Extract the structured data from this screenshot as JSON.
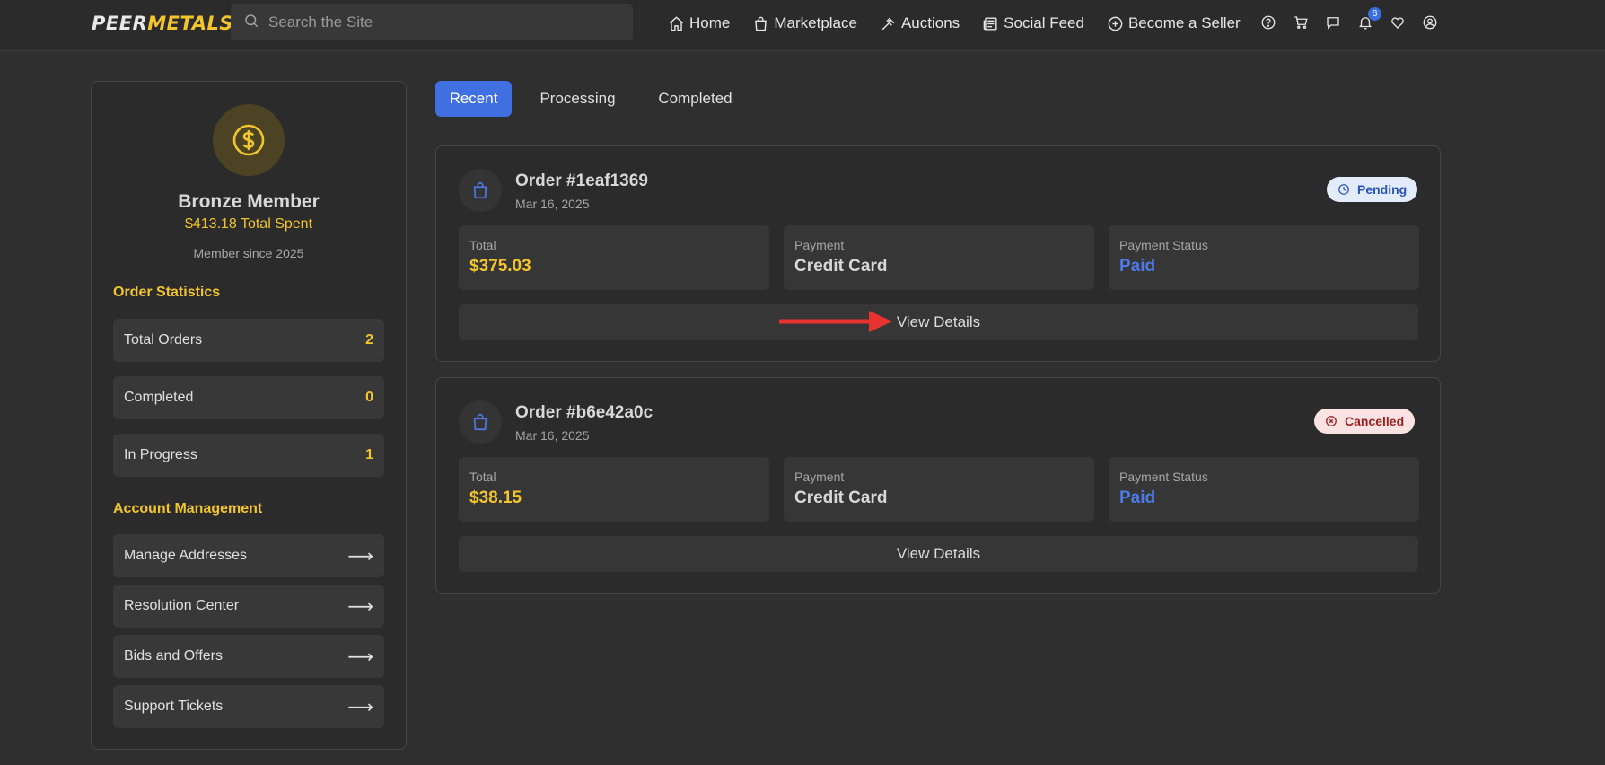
{
  "brand": {
    "peer": "PEER",
    "metals": "METALS",
    "gold": "#f3c52c",
    "accent": "#3f6fe0"
  },
  "search": {
    "placeholder": "Search the Site",
    "icon": "search-icon"
  },
  "nav": {
    "links": [
      {
        "label": "Home",
        "icon": "home-icon"
      },
      {
        "label": "Marketplace",
        "icon": "shopping-bag-icon"
      },
      {
        "label": "Auctions",
        "icon": "gavel-icon"
      },
      {
        "label": "Social Feed",
        "icon": "newspaper-icon"
      },
      {
        "label": "Become a Seller",
        "icon": "plus-circle-icon"
      }
    ],
    "icons": [
      "help-icon",
      "cart-icon",
      "messages-icon",
      "bell-icon",
      "heart-icon",
      "user-icon"
    ],
    "notification_count": "8"
  },
  "profile": {
    "tier": "Bronze Member",
    "total_spent": "$413.18 Total Spent",
    "member_since": "Member since 2025"
  },
  "order_statistics": {
    "title": "Order Statistics",
    "rows": [
      {
        "label": "Total Orders",
        "value": "2"
      },
      {
        "label": "Completed",
        "value": "0"
      },
      {
        "label": "In Progress",
        "value": "1"
      }
    ]
  },
  "account_management": {
    "title": "Account Management",
    "arrow": "⟶",
    "rows": [
      {
        "label": "Manage Addresses"
      },
      {
        "label": "Resolution Center"
      },
      {
        "label": "Bids and Offers"
      },
      {
        "label": "Support Tickets"
      }
    ]
  },
  "tabs": [
    {
      "label": "Recent",
      "active": true
    },
    {
      "label": "Processing",
      "active": false
    },
    {
      "label": "Completed",
      "active": false
    }
  ],
  "orders": [
    {
      "id": "Order #1eaf1369",
      "date": "Mar 16, 2025",
      "status": "Pending",
      "total_label": "Total",
      "total": "$375.03",
      "payment_label": "Payment",
      "payment": "Credit Card",
      "payment_status_label": "Payment Status",
      "payment_status": "Paid",
      "details_label": "View Details"
    },
    {
      "id": "Order #b6e42a0c",
      "date": "Mar 16, 2025",
      "status": "Cancelled",
      "total_label": "Total",
      "total": "$38.15",
      "payment_label": "Payment",
      "payment": "Credit Card",
      "payment_status_label": "Payment Status",
      "payment_status": "Paid",
      "details_label": "View Details"
    }
  ]
}
